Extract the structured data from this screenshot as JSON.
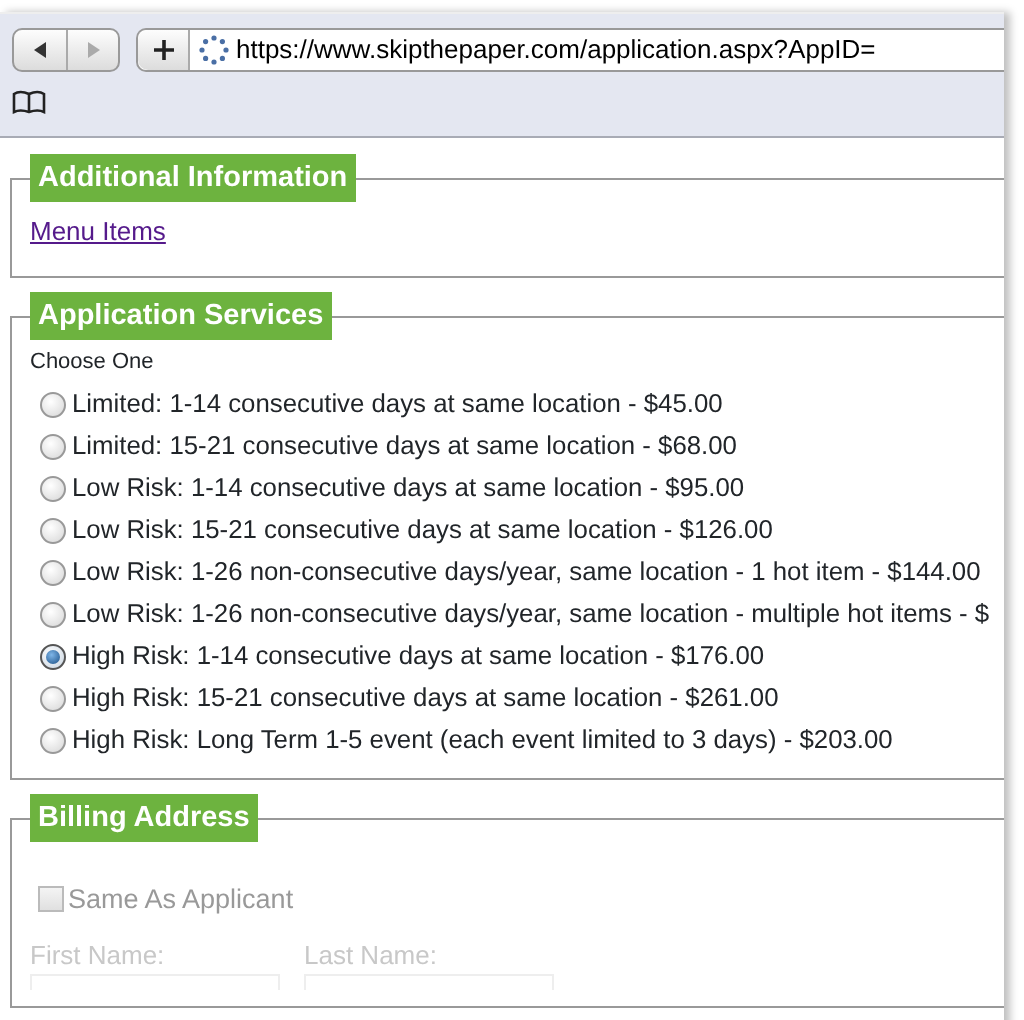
{
  "browser": {
    "url": "https://www.skipthepaper.com/application.aspx?AppID="
  },
  "sections": [
    {
      "kind": "links",
      "title": "Additional Information",
      "links": [
        "Menu Items"
      ]
    },
    {
      "kind": "radios",
      "title": "Application Services",
      "prompt": "Choose One",
      "options": [
        {
          "label": "Limited: 1-14 consecutive days at same location - $45.00",
          "selected": false
        },
        {
          "label": "Limited: 15-21 consecutive days at same location - $68.00",
          "selected": false
        },
        {
          "label": "Low Risk: 1-14 consecutive days at same location - $95.00",
          "selected": false
        },
        {
          "label": "Low Risk: 15-21 consecutive days at same location - $126.00",
          "selected": false
        },
        {
          "label": "Low Risk: 1-26 non-consecutive days/year, same location - 1 hot item - $144.00",
          "selected": false
        },
        {
          "label": "Low Risk: 1-26 non-consecutive days/year, same location - multiple hot items - $",
          "selected": false
        },
        {
          "label": "High Risk: 1-14 consecutive days at same location - $176.00",
          "selected": true
        },
        {
          "label": "High Risk: 15-21 consecutive days at same location - $261.00",
          "selected": false
        },
        {
          "label": "High Risk: Long Term 1-5 event (each event limited to 3 days) - $203.00",
          "selected": false
        }
      ]
    },
    {
      "kind": "billing",
      "title": "Billing Address",
      "same_as_applicant": {
        "label": "Same As Applicant",
        "checked": false
      },
      "fields": [
        {
          "label": "First Name:"
        },
        {
          "label": "Last Name:"
        }
      ]
    }
  ]
}
